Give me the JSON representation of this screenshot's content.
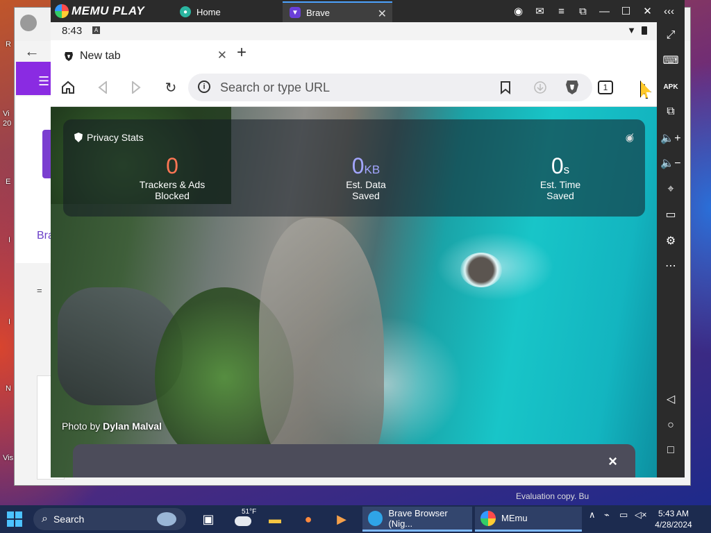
{
  "desktop": {
    "labels": [
      "R",
      "Vi",
      "20",
      "E",
      "I",
      "I",
      "N",
      "Vis"
    ],
    "eval_watermark": "Evaluation copy. Bu"
  },
  "background_window": {
    "brand_text": "Bra",
    "eq_text": "=",
    "back_arrow": "arrow-left-icon",
    "menu_icon": "hamburger-icon"
  },
  "memu": {
    "logo_text": "MEMU PLAY",
    "tabs": [
      {
        "label": "Home",
        "icon": "memu-home-icon"
      },
      {
        "label": "Brave",
        "icon": "brave-icon",
        "active": true
      }
    ],
    "window_controls": [
      "account-icon",
      "mail-icon",
      "menu-icon",
      "screen-icon",
      "minimize-icon",
      "maximize-icon",
      "close-icon",
      "collapse-icon"
    ],
    "sidebar": [
      "fullscreen-icon",
      "keyboard-icon",
      "apk-icon",
      "multi-window-icon",
      "volume-up-icon",
      "volume-down-icon",
      "location-icon",
      "folder-icon",
      "settings-icon",
      "more-icon",
      "back-nav-icon",
      "home-nav-icon",
      "recents-nav-icon"
    ],
    "sidebar_apk_text": "APK"
  },
  "android": {
    "status": {
      "time": "8:43",
      "a_badge": "A"
    },
    "browser": {
      "tab_label": "New tab",
      "tab_count": "1",
      "url_placeholder": "Search or type URL"
    },
    "ntp": {
      "privacy_stats_title": "Privacy Stats",
      "stats": [
        {
          "value": "0",
          "unit": "",
          "label_line1": "Trackers & Ads",
          "label_line2": "Blocked",
          "color": "#ff7654"
        },
        {
          "value": "0",
          "unit": "KB",
          "label_line1": "Est. Data",
          "label_line2": "Saved",
          "color": "#a3a6ff"
        },
        {
          "value": "0",
          "unit": "s",
          "label_line1": "Est. Time",
          "label_line2": "Saved",
          "color": "#ffffff"
        }
      ],
      "photo_credit_prefix": "Photo by",
      "photo_credit_name": "Dylan Malval",
      "bottom_close": "×"
    }
  },
  "taskbar": {
    "search_placeholder": "Search",
    "weather_temp": "51°F",
    "apps": [
      {
        "label": "Brave Browser (Nig...",
        "icon": "edge-icon",
        "color": "#2fa4e7"
      },
      {
        "label": "MEmu",
        "icon": "memu-icon",
        "color": "#8a5cf0"
      }
    ],
    "clock_time": "5:43 AM",
    "clock_date": "4/28/2024"
  },
  "colors": {
    "memu_chrome": "#2b2b2b",
    "brave_orange": "#ff7654",
    "brave_purple": "#a3a6ff",
    "taskbar": "#1c2b4f"
  }
}
